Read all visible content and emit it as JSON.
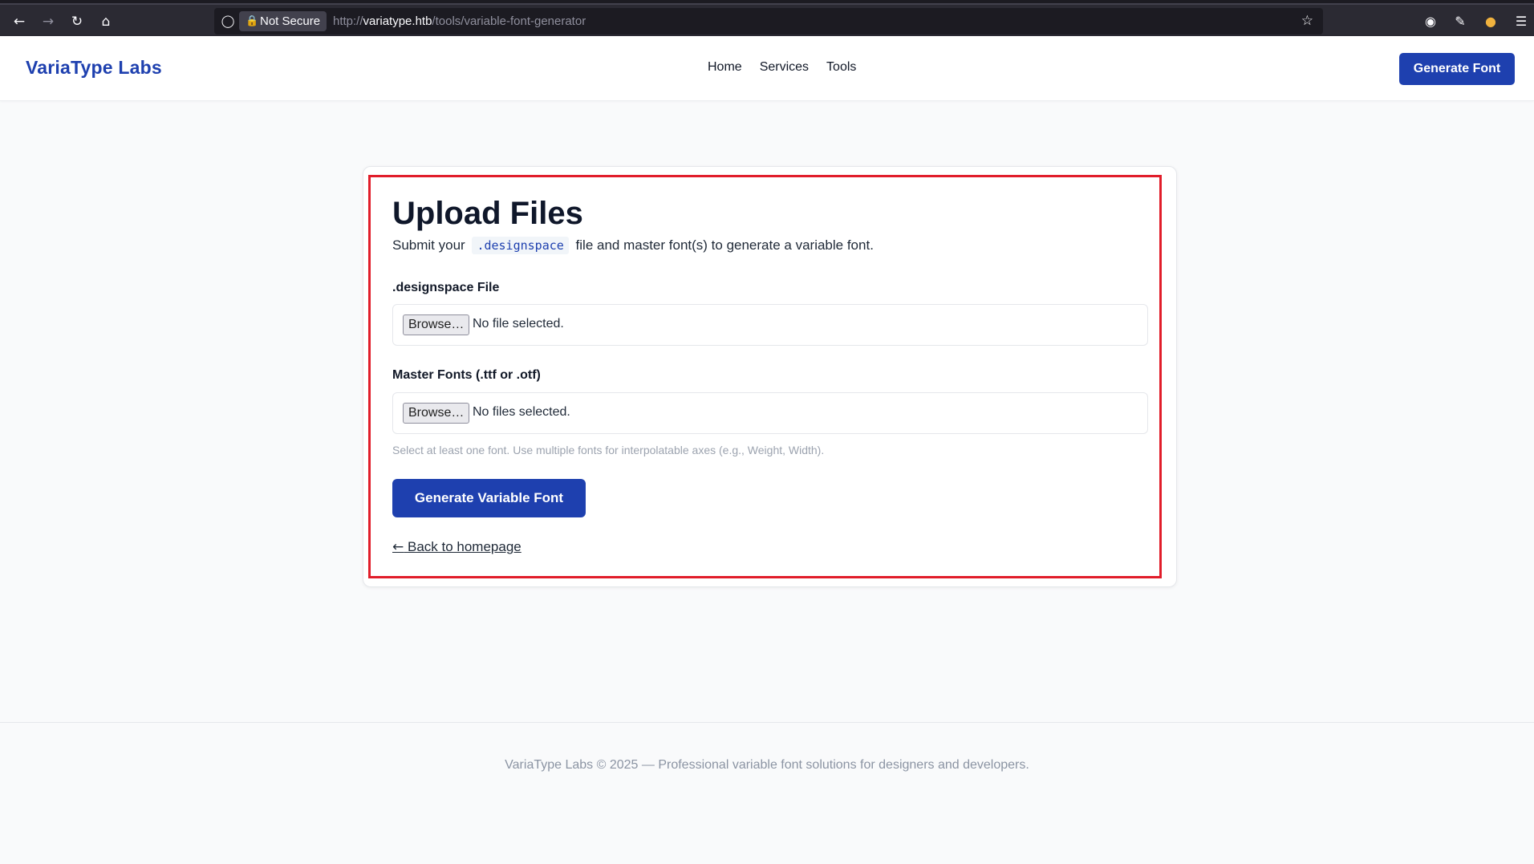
{
  "browser": {
    "security_label": "Not Secure",
    "url_scheme": "http://",
    "url_host": "variatype.htb",
    "url_path": "/tools/variable-font-generator",
    "icons": [
      "back-icon",
      "forward-icon",
      "reload-icon",
      "home-icon",
      "shield-icon",
      "lock-icon",
      "star-icon",
      "account-icon",
      "extensions-icon",
      "extension-icon",
      "menu-icon"
    ]
  },
  "header": {
    "brand": "VariaType Labs",
    "nav": [
      "Home",
      "Services",
      "Tools"
    ],
    "cta_label": "Generate Font"
  },
  "main": {
    "title": "Upload Files",
    "subtitle_before": "Submit your",
    "subtitle_code": ".designspace",
    "subtitle_after": "file and master font(s) to generate a variable font.",
    "designspace": {
      "label": ".designspace File",
      "browse_label": "Browse…",
      "status": "No file selected."
    },
    "masters": {
      "label": "Master Fonts (.ttf or .otf)",
      "browse_label": "Browse…",
      "status": "No files selected."
    },
    "hint": "Select at least one font. Use multiple fonts for interpolatable axes (e.g., Weight, Width).",
    "submit_label": "Generate Variable Font",
    "back_arrow": "←",
    "back_label": "Back to homepage"
  },
  "footer": {
    "text": "VariaType Labs © 2025 — Professional variable font solutions for designers and developers."
  },
  "colors": {
    "brand_blue": "#1e40af",
    "highlight_red": "#e11d2a"
  }
}
